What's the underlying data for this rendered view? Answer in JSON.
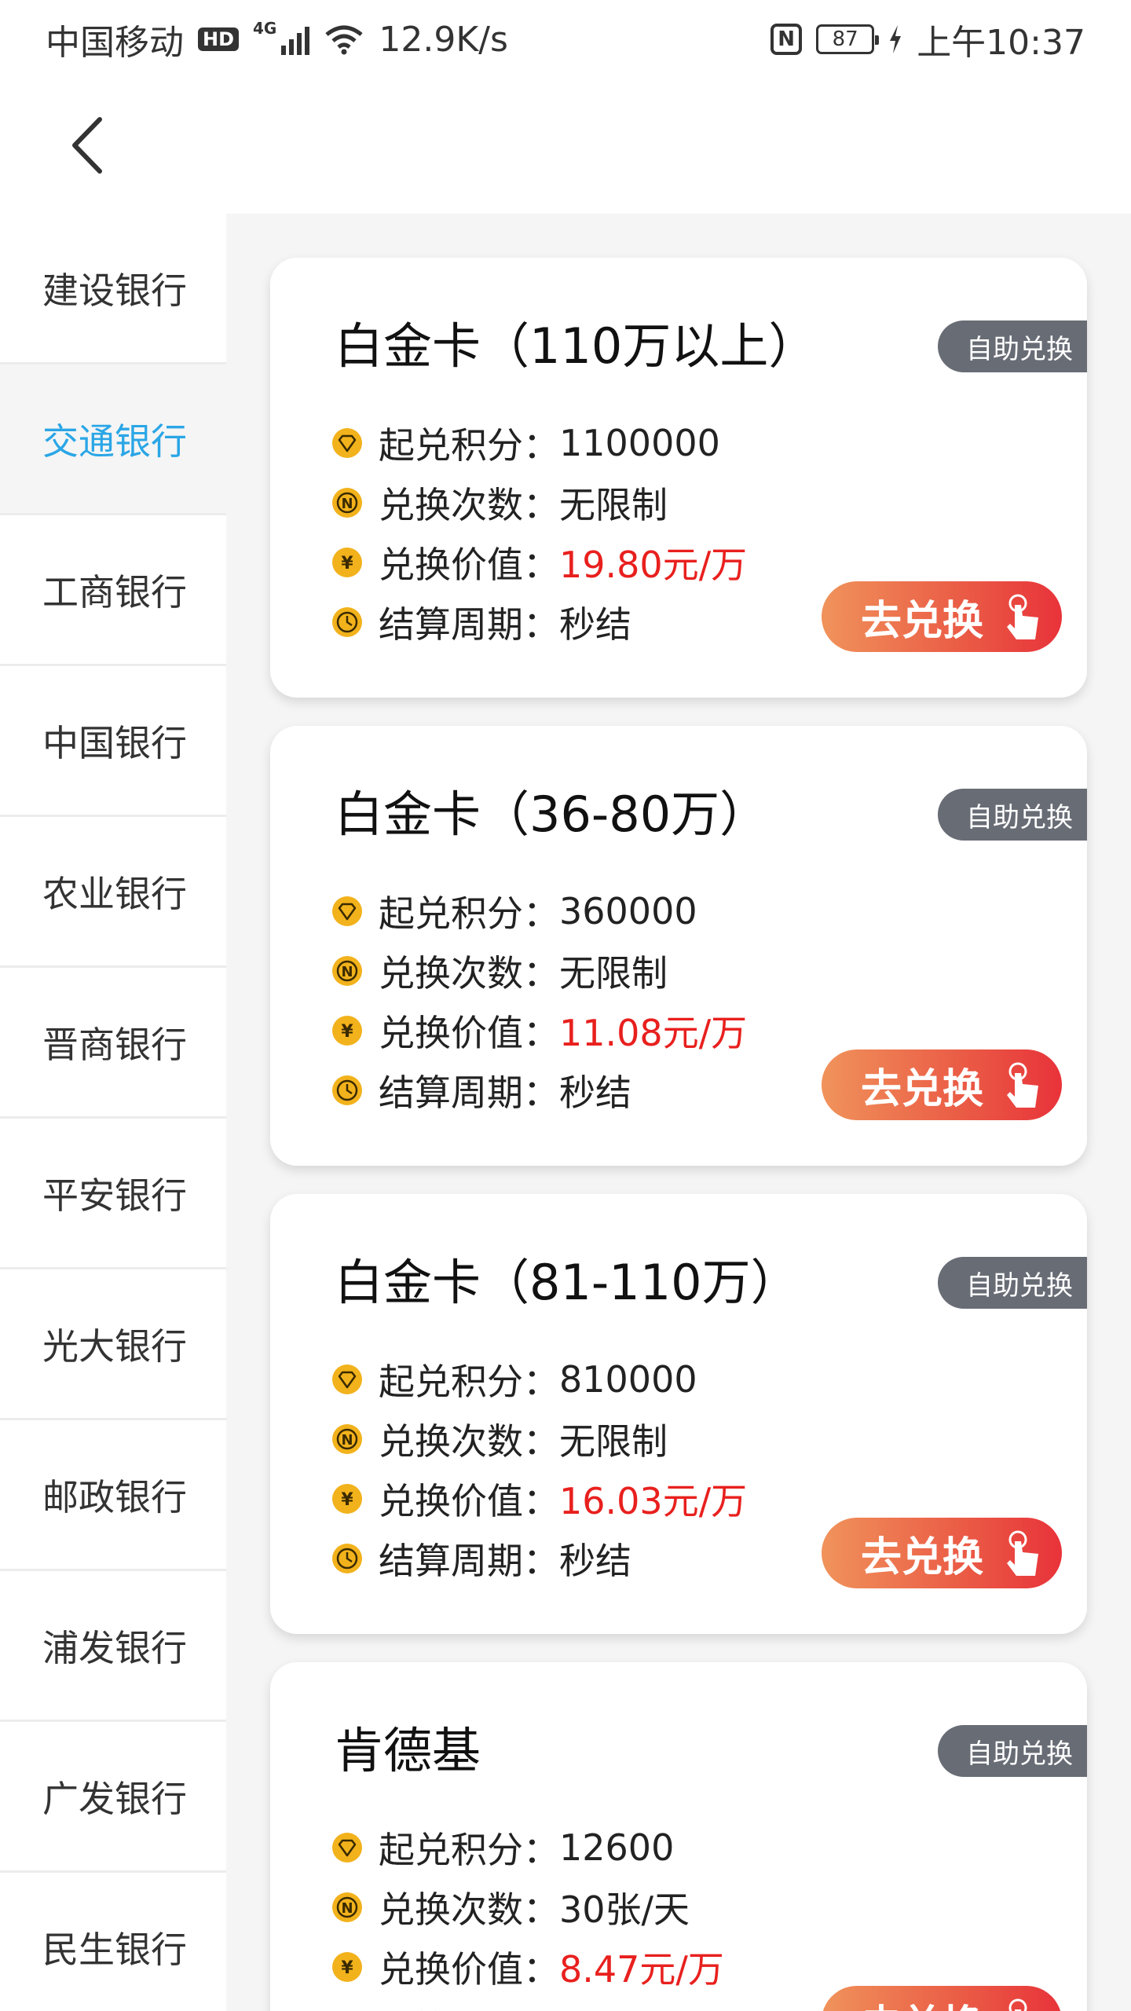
{
  "status_bar": {
    "carrier": "中国移动",
    "hd": "HD",
    "network": "4G",
    "speed": "12.9K/s",
    "nfc": "N",
    "battery": "87",
    "time": "上午10:37"
  },
  "sidebar": {
    "items": [
      {
        "label": "建设银行",
        "active": false
      },
      {
        "label": "交通银行",
        "active": true
      },
      {
        "label": "工商银行",
        "active": false
      },
      {
        "label": "中国银行",
        "active": false
      },
      {
        "label": "农业银行",
        "active": false
      },
      {
        "label": "晋商银行",
        "active": false
      },
      {
        "label": "平安银行",
        "active": false
      },
      {
        "label": "光大银行",
        "active": false
      },
      {
        "label": "邮政银行",
        "active": false
      },
      {
        "label": "浦发银行",
        "active": false
      },
      {
        "label": "广发银行",
        "active": false
      },
      {
        "label": "民生银行",
        "active": false
      }
    ]
  },
  "labels": {
    "points": "起兑积分：",
    "times": "兑换次数：",
    "value": "兑换价值：",
    "settle": "结算周期："
  },
  "cards": [
    {
      "title": "白金卡（110万以上）",
      "badge": "自助兑换",
      "points": "1100000",
      "times": "无限制",
      "value": "19.80元/万",
      "settle": "秒结",
      "button": "去兑换"
    },
    {
      "title": "白金卡（36-80万）",
      "badge": "自助兑换",
      "points": "360000",
      "times": "无限制",
      "value": "11.08元/万",
      "settle": "秒结",
      "button": "去兑换"
    },
    {
      "title": "白金卡（81-110万）",
      "badge": "自助兑换",
      "points": "810000",
      "times": "无限制",
      "value": "16.03元/万",
      "settle": "秒结",
      "button": "去兑换"
    },
    {
      "title": "肯德基",
      "badge": "自助兑换",
      "points": "12600",
      "times": "30张/天",
      "value": "8.47元/万",
      "settle": "",
      "button": "去兑换"
    }
  ],
  "colors": {
    "accent_blue": "#2aa6e6",
    "value_red": "#e8201e",
    "badge_gray": "#686c75",
    "icon_gold": "#f2b21c"
  }
}
